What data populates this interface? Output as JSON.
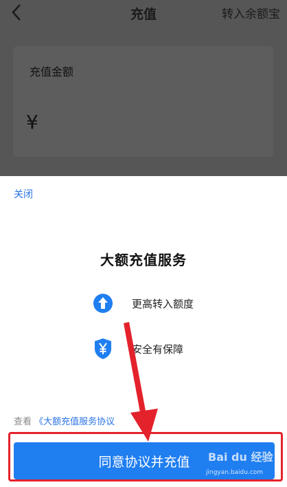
{
  "header": {
    "title": "充值",
    "action_label": "转入余额宝"
  },
  "amount": {
    "label": "充值金额",
    "currency_symbol": "¥"
  },
  "sheet": {
    "close_label": "关闭",
    "title": "大额充值服务",
    "features": [
      {
        "icon": "up-arrow-circle-icon",
        "label": "更高转入额度"
      },
      {
        "icon": "yen-shield-icon",
        "label": "安全有保障"
      }
    ],
    "agreement": {
      "prefix": "查看",
      "link": "《大额充值服务协议"
    },
    "confirm_label": "同意协议并充值"
  },
  "colors": {
    "accent": "#1f7ef0",
    "link": "#2a73e6",
    "annotation": "#e3222c"
  },
  "watermark": {
    "logo": "Bai du 经验",
    "url": "jingyan.baidu.com"
  }
}
